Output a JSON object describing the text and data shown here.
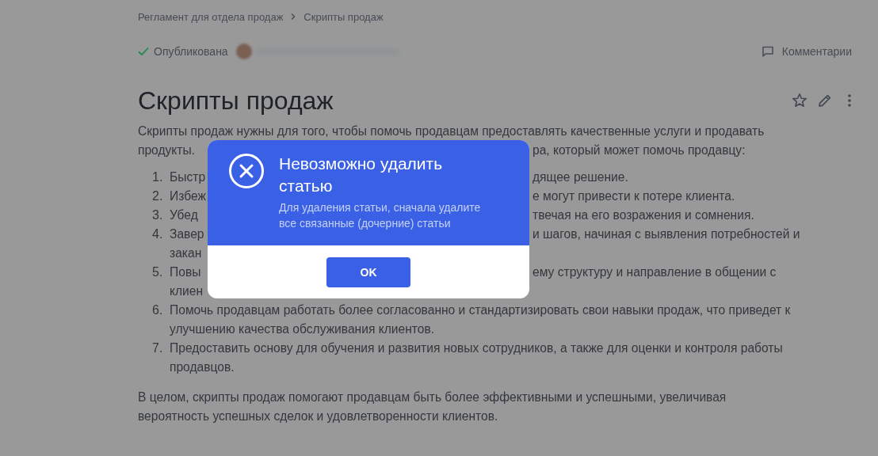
{
  "breadcrumbs": [
    {
      "label": "Регламент для отдела продаж"
    },
    {
      "label": "Скрипты продаж"
    }
  ],
  "status": {
    "label": "Опубликована",
    "published": true
  },
  "comments": {
    "label": "Комментарии"
  },
  "article": {
    "title": "Скрипты продаж",
    "intro": [
      {
        "kind": "full",
        "text": "Скрипты продаж нужны для того, чтобы помочь продавцам предоставлять качественные услуги и продавать"
      },
      {
        "kind": "split",
        "left": "продукты.",
        "right": "ра, который может помочь продавцу:"
      }
    ],
    "items": [
      {
        "number": "1.",
        "lines": [
          {
            "kind": "split",
            "left": "Быстр",
            "right": "дящее решение."
          }
        ]
      },
      {
        "number": "2.",
        "lines": [
          {
            "kind": "split",
            "left": "Избеж",
            "right": "е могут привести к потере клиента."
          }
        ]
      },
      {
        "number": "3.",
        "lines": [
          {
            "kind": "split",
            "left": "Убед",
            "right": "твечая на его возражения и сомнения."
          }
        ]
      },
      {
        "number": "4.",
        "lines": [
          {
            "kind": "split",
            "left": "Завер",
            "right": "и шагов, начиная с выявления потребностей и"
          },
          {
            "kind": "split",
            "left": "закан"
          }
        ]
      },
      {
        "number": "5.",
        "lines": [
          {
            "kind": "split",
            "left": "Повы",
            "right": "ему структуру и направление в общении с"
          },
          {
            "kind": "split",
            "left": "клиен"
          }
        ]
      },
      {
        "number": "6.",
        "lines": [
          {
            "kind": "full",
            "text": "Помочь продавцам работать более согласованно и стандартизировать свои навыки продаж, что приведет к улучшению качества обслуживания клиентов."
          }
        ]
      },
      {
        "number": "7.",
        "lines": [
          {
            "kind": "full",
            "text": "Предоставить основу для обучения и развития новых сотрудников, а также для оценки и контроля работы продавцов."
          }
        ]
      }
    ],
    "conclusion": "В целом, скрипты продаж помогают продавцам быть более эффективными и успешными, увеличивая вероятность успешных сделок и удовлетворенности клиентов."
  },
  "dialog": {
    "title": "Невозможно удалить статью",
    "message": "Для удаления статьи, сначала удалите все связанные (дочерние) статьи",
    "button": "OK"
  }
}
